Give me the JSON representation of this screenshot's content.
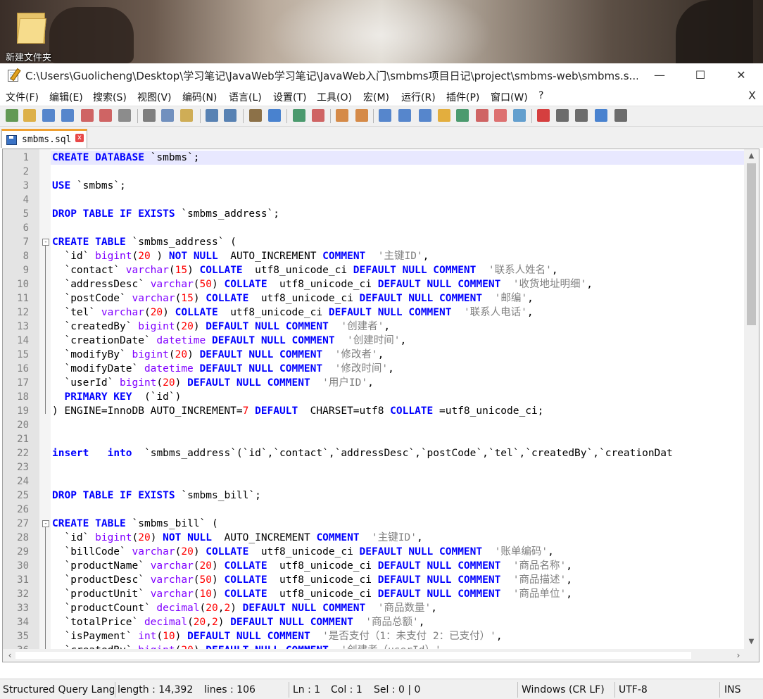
{
  "desktop": {
    "folder_label": "新建文件夹"
  },
  "window": {
    "title": "C:\\Users\\Guolicheng\\Desktop\\学习笔记\\JavaWeb学习笔记\\JavaWeb入门\\smbms项目日记\\project\\smbms-web\\smbms.s...",
    "minimize": "—",
    "maximize": "☐",
    "close": "✕"
  },
  "menu": {
    "items": [
      "文件(F)",
      "编辑(E)",
      "搜索(S)",
      "视图(V)",
      "编码(N)",
      "语言(L)",
      "设置(T)",
      "工具(O)",
      "宏(M)",
      "运行(R)",
      "插件(P)",
      "窗口(W)",
      "?"
    ],
    "close_doc": "X"
  },
  "toolbar": {
    "icons": [
      "new-file-icon",
      "open-file-icon",
      "save-icon",
      "save-all-icon",
      "close-icon",
      "close-all-icon",
      "print-icon",
      "cut-icon",
      "copy-icon",
      "paste-icon",
      "undo-icon",
      "redo-icon",
      "find-icon",
      "replace-icon",
      "zoom-in-icon",
      "zoom-out-icon",
      "sync-vertical-icon",
      "sync-horizontal-icon",
      "word-wrap-icon",
      "show-all-chars-icon",
      "indent-guide-icon",
      "user-lang-icon",
      "doc-map-icon",
      "function-list-icon",
      "folder-workspace-icon",
      "monitor-icon",
      "record-macro-icon",
      "stop-macro-icon",
      "play-macro-icon",
      "run-macro-multiple-icon",
      "save-macro-icon"
    ]
  },
  "tabs": [
    {
      "label": "smbms.sql",
      "close": "x"
    }
  ],
  "editor": {
    "lines": [
      {
        "n": "1",
        "tokens": [
          [
            "kw",
            "CREATE DATABASE"
          ],
          [
            "",
            "`smbms`;"
          ]
        ]
      },
      {
        "n": "2",
        "tokens": []
      },
      {
        "n": "3",
        "tokens": [
          [
            "kw",
            "USE"
          ],
          [
            "",
            "`smbms`;"
          ]
        ]
      },
      {
        "n": "4",
        "tokens": []
      },
      {
        "n": "5",
        "tokens": [
          [
            "kw",
            "DROP TABLE IF EXISTS"
          ],
          [
            "",
            "`smbms_address`;"
          ]
        ]
      },
      {
        "n": "6",
        "tokens": []
      },
      {
        "n": "7",
        "fold": "-",
        "tokens": [
          [
            "kw",
            "CREATE TABLE"
          ],
          [
            "",
            "`smbms_address` ("
          ]
        ]
      },
      {
        "n": "8",
        "tokens": [
          [
            "",
            "  `id` "
          ],
          [
            "ty",
            "bigint"
          ],
          [
            "",
            "("
          ],
          [
            "num",
            "20"
          ],
          [
            "",
            " ) "
          ],
          [
            "kw",
            "NOT NULL"
          ],
          [
            "",
            " AUTO_INCREMENT "
          ],
          [
            "kw",
            "COMMENT"
          ],
          [
            "str",
            " '主键ID'"
          ],
          [
            "",
            ","
          ]
        ]
      },
      {
        "n": "9",
        "tokens": [
          [
            "",
            "  `contact` "
          ],
          [
            "ty",
            "varchar"
          ],
          [
            "",
            "("
          ],
          [
            "num",
            "15"
          ],
          [
            "",
            ") "
          ],
          [
            "kw",
            "COLLATE"
          ],
          [
            "",
            " utf8_unicode_ci "
          ],
          [
            "kw",
            "DEFAULT NULL COMMENT"
          ],
          [
            "str",
            " '联系人姓名'"
          ],
          [
            "",
            ","
          ]
        ]
      },
      {
        "n": "10",
        "tokens": [
          [
            "",
            "  `addressDesc` "
          ],
          [
            "ty",
            "varchar"
          ],
          [
            "",
            "("
          ],
          [
            "num",
            "50"
          ],
          [
            "",
            ") "
          ],
          [
            "kw",
            "COLLATE"
          ],
          [
            "",
            " utf8_unicode_ci "
          ],
          [
            "kw",
            "DEFAULT NULL COMMENT"
          ],
          [
            "str",
            " '收货地址明细'"
          ],
          [
            "",
            ","
          ]
        ]
      },
      {
        "n": "11",
        "tokens": [
          [
            "",
            "  `postCode` "
          ],
          [
            "ty",
            "varchar"
          ],
          [
            "",
            "("
          ],
          [
            "num",
            "15"
          ],
          [
            "",
            ") "
          ],
          [
            "kw",
            "COLLATE"
          ],
          [
            "",
            " utf8_unicode_ci "
          ],
          [
            "kw",
            "DEFAULT NULL COMMENT"
          ],
          [
            "str",
            " '邮编'"
          ],
          [
            "",
            ","
          ]
        ]
      },
      {
        "n": "12",
        "tokens": [
          [
            "",
            "  `tel` "
          ],
          [
            "ty",
            "varchar"
          ],
          [
            "",
            "("
          ],
          [
            "num",
            "20"
          ],
          [
            "",
            ") "
          ],
          [
            "kw",
            "COLLATE"
          ],
          [
            "",
            " utf8_unicode_ci "
          ],
          [
            "kw",
            "DEFAULT NULL COMMENT"
          ],
          [
            "str",
            " '联系人电话'"
          ],
          [
            "",
            ","
          ]
        ]
      },
      {
        "n": "13",
        "tokens": [
          [
            "",
            "  `createdBy` "
          ],
          [
            "ty",
            "bigint"
          ],
          [
            "",
            "("
          ],
          [
            "num",
            "20"
          ],
          [
            "",
            ") "
          ],
          [
            "kw",
            "DEFAULT NULL COMMENT"
          ],
          [
            "str",
            " '创建者'"
          ],
          [
            "",
            ","
          ]
        ]
      },
      {
        "n": "14",
        "tokens": [
          [
            "",
            "  `creationDate` "
          ],
          [
            "ty",
            "datetime"
          ],
          [
            "",
            " "
          ],
          [
            "kw",
            "DEFAULT NULL COMMENT"
          ],
          [
            "str",
            " '创建时间'"
          ],
          [
            "",
            ","
          ]
        ]
      },
      {
        "n": "15",
        "tokens": [
          [
            "",
            "  `modifyBy` "
          ],
          [
            "ty",
            "bigint"
          ],
          [
            "",
            "("
          ],
          [
            "num",
            "20"
          ],
          [
            "",
            ") "
          ],
          [
            "kw",
            "DEFAULT NULL COMMENT"
          ],
          [
            "str",
            " '修改者'"
          ],
          [
            "",
            ","
          ]
        ]
      },
      {
        "n": "16",
        "tokens": [
          [
            "",
            "  `modifyDate` "
          ],
          [
            "ty",
            "datetime"
          ],
          [
            "",
            " "
          ],
          [
            "kw",
            "DEFAULT NULL COMMENT"
          ],
          [
            "str",
            " '修改时间'"
          ],
          [
            "",
            ","
          ]
        ]
      },
      {
        "n": "17",
        "tokens": [
          [
            "",
            "  `userId` "
          ],
          [
            "ty",
            "bigint"
          ],
          [
            "",
            "("
          ],
          [
            "num",
            "20"
          ],
          [
            "",
            ") "
          ],
          [
            "kw",
            "DEFAULT NULL COMMENT"
          ],
          [
            "str",
            " '用户ID'"
          ],
          [
            "",
            ","
          ]
        ]
      },
      {
        "n": "18",
        "tokens": [
          [
            "",
            "  "
          ],
          [
            "kw",
            "PRIMARY KEY"
          ],
          [
            "",
            " (`id`)"
          ]
        ]
      },
      {
        "n": "19",
        "foldend": true,
        "tokens": [
          [
            "",
            ") ENGINE=InnoDB AUTO_INCREMENT="
          ],
          [
            "num",
            "7"
          ],
          [
            "",
            " "
          ],
          [
            "kw",
            "DEFAULT"
          ],
          [
            "",
            " CHARSET=utf8 "
          ],
          [
            "kw",
            "COLLATE"
          ],
          [
            "",
            "=utf8_unicode_ci;"
          ]
        ]
      },
      {
        "n": "20",
        "tokens": []
      },
      {
        "n": "21",
        "tokens": []
      },
      {
        "n": "22",
        "tokens": [
          [
            "kw",
            "insert"
          ],
          [
            "",
            "  "
          ],
          [
            "kw",
            "into"
          ],
          [
            "",
            " `smbms_address`(`id`,`contact`,`addressDesc`,`postCode`,`tel`,`createdBy`,`creationDat"
          ]
        ]
      },
      {
        "n": "23",
        "tokens": []
      },
      {
        "n": "24",
        "tokens": []
      },
      {
        "n": "25",
        "tokens": [
          [
            "kw",
            "DROP TABLE IF EXISTS"
          ],
          [
            "",
            "`smbms_bill`;"
          ]
        ]
      },
      {
        "n": "26",
        "tokens": []
      },
      {
        "n": "27",
        "fold": "-",
        "tokens": [
          [
            "kw",
            "CREATE TABLE"
          ],
          [
            "",
            "`smbms_bill` ("
          ]
        ]
      },
      {
        "n": "28",
        "tokens": [
          [
            "",
            "  `id` "
          ],
          [
            "ty",
            "bigint"
          ],
          [
            "",
            "("
          ],
          [
            "num",
            "20"
          ],
          [
            "",
            ") "
          ],
          [
            "kw",
            "NOT NULL"
          ],
          [
            "",
            " AUTO_INCREMENT "
          ],
          [
            "kw",
            "COMMENT"
          ],
          [
            "str",
            " '主键ID'"
          ],
          [
            "",
            ","
          ]
        ]
      },
      {
        "n": "29",
        "tokens": [
          [
            "",
            "  `billCode` "
          ],
          [
            "ty",
            "varchar"
          ],
          [
            "",
            "("
          ],
          [
            "num",
            "20"
          ],
          [
            "",
            ") "
          ],
          [
            "kw",
            "COLLATE"
          ],
          [
            "",
            " utf8_unicode_ci "
          ],
          [
            "kw",
            "DEFAULT NULL COMMENT"
          ],
          [
            "str",
            " '账单编码'"
          ],
          [
            "",
            ","
          ]
        ]
      },
      {
        "n": "30",
        "tokens": [
          [
            "",
            "  `productName` "
          ],
          [
            "ty",
            "varchar"
          ],
          [
            "",
            "("
          ],
          [
            "num",
            "20"
          ],
          [
            "",
            ") "
          ],
          [
            "kw",
            "COLLATE"
          ],
          [
            "",
            " utf8_unicode_ci "
          ],
          [
            "kw",
            "DEFAULT NULL COMMENT"
          ],
          [
            "str",
            " '商品名称'"
          ],
          [
            "",
            ","
          ]
        ]
      },
      {
        "n": "31",
        "tokens": [
          [
            "",
            "  `productDesc` "
          ],
          [
            "ty",
            "varchar"
          ],
          [
            "",
            "("
          ],
          [
            "num",
            "50"
          ],
          [
            "",
            ") "
          ],
          [
            "kw",
            "COLLATE"
          ],
          [
            "",
            " utf8_unicode_ci "
          ],
          [
            "kw",
            "DEFAULT NULL COMMENT"
          ],
          [
            "str",
            " '商品描述'"
          ],
          [
            "",
            ","
          ]
        ]
      },
      {
        "n": "32",
        "tokens": [
          [
            "",
            "  `productUnit` "
          ],
          [
            "ty",
            "varchar"
          ],
          [
            "",
            "("
          ],
          [
            "num",
            "10"
          ],
          [
            "",
            ") "
          ],
          [
            "kw",
            "COLLATE"
          ],
          [
            "",
            " utf8_unicode_ci "
          ],
          [
            "kw",
            "DEFAULT NULL COMMENT"
          ],
          [
            "str",
            " '商品单位'"
          ],
          [
            "",
            ","
          ]
        ]
      },
      {
        "n": "33",
        "tokens": [
          [
            "",
            "  `productCount` "
          ],
          [
            "ty",
            "decimal"
          ],
          [
            "",
            "("
          ],
          [
            "num",
            "20"
          ],
          [
            "",
            ","
          ],
          [
            "num",
            "2"
          ],
          [
            "",
            ") "
          ],
          [
            "kw",
            "DEFAULT NULL COMMENT"
          ],
          [
            "str",
            " '商品数量'"
          ],
          [
            "",
            ","
          ]
        ]
      },
      {
        "n": "34",
        "tokens": [
          [
            "",
            "  `totalPrice` "
          ],
          [
            "ty",
            "decimal"
          ],
          [
            "",
            "("
          ],
          [
            "num",
            "20"
          ],
          [
            "",
            ","
          ],
          [
            "num",
            "2"
          ],
          [
            "",
            ") "
          ],
          [
            "kw",
            "DEFAULT NULL COMMENT"
          ],
          [
            "str",
            " '商品总额'"
          ],
          [
            "",
            ","
          ]
        ]
      },
      {
        "n": "35",
        "tokens": [
          [
            "",
            "  `isPayment` "
          ],
          [
            "ty",
            "int"
          ],
          [
            "",
            "("
          ],
          [
            "num",
            "10"
          ],
          [
            "",
            ") "
          ],
          [
            "kw",
            "DEFAULT NULL COMMENT"
          ],
          [
            "str",
            " '是否支付（1：未支付 2：已支付）'"
          ],
          [
            "",
            ","
          ]
        ]
      },
      {
        "n": "36",
        "tokens": [
          [
            "",
            "  `createdBy` "
          ],
          [
            "ty",
            "bigint"
          ],
          [
            "",
            "("
          ],
          [
            "num",
            "20"
          ],
          [
            "",
            ") "
          ],
          [
            "kw",
            "DEFAULT NULL COMMENT"
          ],
          [
            "str",
            " '创建者（userId）'"
          ],
          [
            "",
            ","
          ]
        ]
      }
    ]
  },
  "status": {
    "language": "Structured Query Lang",
    "length": "length : 14,392",
    "lines": "lines : 106",
    "ln": "Ln : 1",
    "col": "Col : 1",
    "sel": "Sel : 0 | 0",
    "eol": "Windows (CR LF)",
    "encoding": "UTF-8",
    "mode": "INS"
  },
  "colors": {
    "keyword": "#0000ff",
    "type": "#8000ff",
    "number": "#ff0000",
    "string": "#808080",
    "current_line": "#e8e8ff",
    "tab_accent": "#f0a030"
  }
}
